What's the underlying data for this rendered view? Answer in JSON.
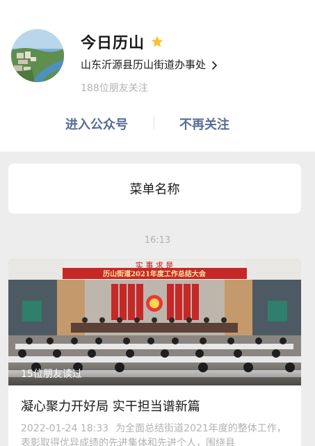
{
  "account": {
    "name": "今日历山",
    "organization": "山东沂源县历山街道办事处",
    "followers_text": "188位朋友关注",
    "star_color": "#fbc02d"
  },
  "actions": {
    "enter_label": "进入公众号",
    "unfollow_label": "不再关注"
  },
  "menu": {
    "label": "菜单名称"
  },
  "feed": {
    "time": "16:13"
  },
  "article": {
    "readers_text": "15位朋友读过",
    "title": "凝心聚力开好局 实干担当谱新篇",
    "date": "2022-01-24 18:33",
    "summary": "为全面总结街道2021年度的整体工作，表彰取得优异成绩的先进集体和先进个人，围绕县",
    "banner_text": "历山街道2021年度工作总结大会",
    "slogan_text": "实 事 求 是"
  },
  "colors": {
    "link": "#576b95",
    "secondary": "#b2b2b2",
    "banner_red": "#c62828"
  }
}
